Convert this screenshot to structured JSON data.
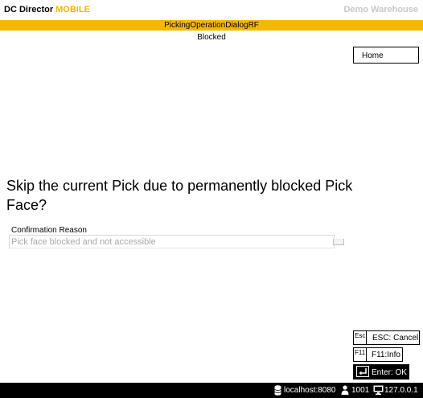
{
  "header": {
    "brand": "DC Director",
    "brand_suffix": "MOBILE",
    "warehouse": "Demo Warehouse"
  },
  "dialog": {
    "name": "PickingOperationDialogRF",
    "status": "Blocked"
  },
  "nav": {
    "home_label": "Home"
  },
  "main": {
    "question": "Skip the current Pick due to permanently blocked Pick Face?",
    "reason_label": "Confirmation Reason",
    "reason_value": "Pick face blocked and not accessible"
  },
  "actions": {
    "esc_key": "Esc",
    "esc_label": "ESC: Cancel",
    "f11_key": "F11",
    "f11_label": "F11:Info",
    "enter_label": "Enter: OK"
  },
  "statusbar": {
    "server": "localhost:8080",
    "user": "1001",
    "client": "127.0.0.1"
  },
  "colors": {
    "accent": "#f5b800",
    "brand_accent": "#f0b400",
    "muted": "#c8c8c8"
  }
}
